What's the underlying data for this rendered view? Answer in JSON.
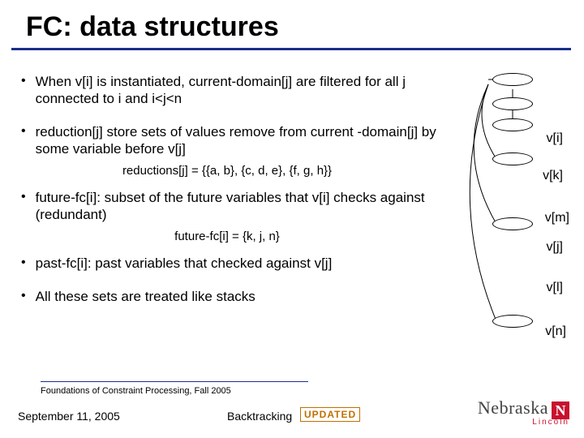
{
  "title": "FC: data structures",
  "bullets": {
    "b1": "When v[i] is instantiated, current-domain[j] are filtered for all j connected to i and i<j<n",
    "b2": "reduction[j] store sets of values remove from current -domain[j] by some variable before v[j]",
    "b2sub": "reductions[j] = {{a, b}, {c, d, e}, {f, g, h}}",
    "b3": "future-fc[i]: subset of the future variables that v[i] checks against (redundant)",
    "b3sub": "future-fc[i] = {k, j, n}",
    "b4": "past-fc[i]: past variables that checked against v[j]",
    "b5": "All these sets are treated like stacks"
  },
  "labels": {
    "vi": "v[i]",
    "vk": "v[k]",
    "vm": "v[m]",
    "vj": "v[j]",
    "vl": "v[l]",
    "vn": "v[n]"
  },
  "footer": {
    "course": "Foundations of Constraint Processing, Fall 2005",
    "date": "September 11, 2005",
    "topic": "Backtracking",
    "badge": "UPDATED"
  },
  "logo": {
    "uni": "Nebraska",
    "city": "Lincoln",
    "mark": "N"
  }
}
